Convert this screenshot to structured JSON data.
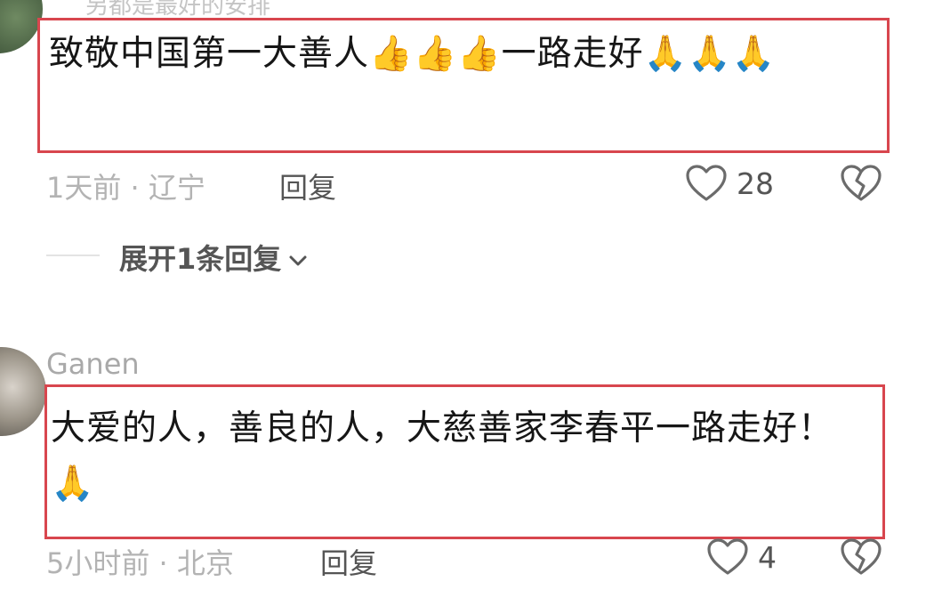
{
  "comments": [
    {
      "username": "另都是最好的安排",
      "text": "致敬中国第一大善人👍👍👍一路走好🙏🙏🙏",
      "meta": "1天前 · 辽宁",
      "reply_label": "回复",
      "likes": "28",
      "expand_label": "展开1条回复"
    },
    {
      "username": "Ganen",
      "text": "大爱的人，善良的人，大慈善家李春平一路走好！ 🙏",
      "meta": "5小时前 · 北京",
      "reply_label": "回复",
      "likes": "4"
    }
  ],
  "colors": {
    "highlight_border": "#d8464e",
    "meta_text": "#b3b3b3",
    "icon_stroke": "#6b6b6b"
  },
  "icons": [
    "heart-icon",
    "broken-heart-icon",
    "chevron-down-icon"
  ]
}
